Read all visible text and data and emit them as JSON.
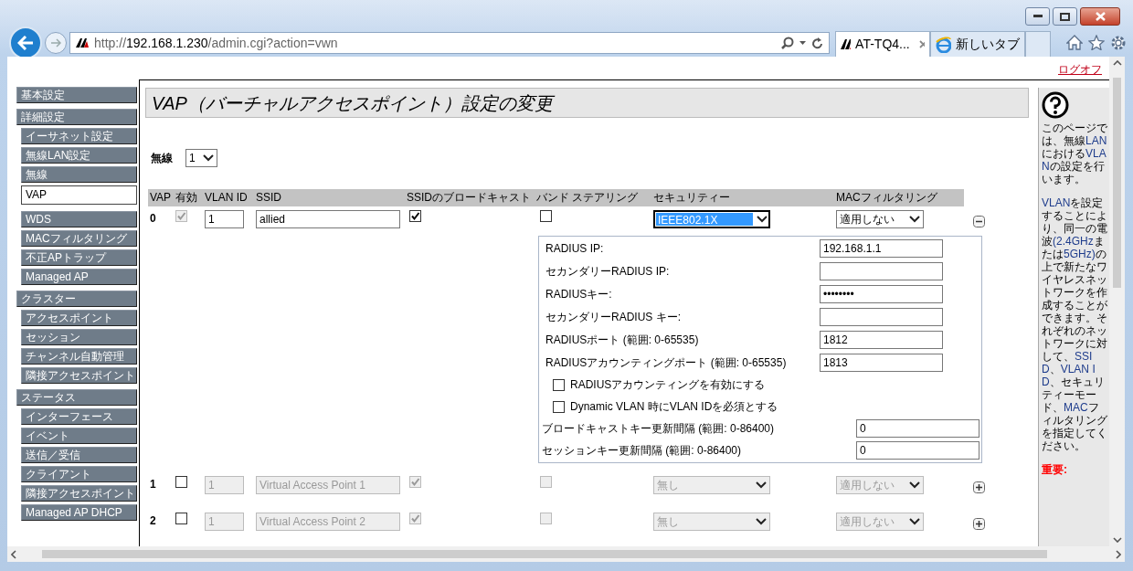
{
  "browser": {
    "address": "http://192.168.1.230/admin.cgi?action=vwn",
    "tabs": [
      {
        "label": "AT-TQ4...",
        "selected": true
      },
      {
        "label": "新しいタブ",
        "selected": false
      }
    ]
  },
  "logoff": "ログオフ",
  "sidebar": {
    "groups": [
      {
        "label": "基本設定"
      },
      {
        "label": "詳細設定",
        "items": [
          {
            "label": "イーサネット設定",
            "selected": false
          },
          {
            "label": "無線LAN設定",
            "selected": false
          },
          {
            "label": "無線",
            "selected": false
          },
          {
            "label": "VAP",
            "selected": true
          },
          {
            "label": "WDS",
            "selected": false
          },
          {
            "label": "MACフィルタリング",
            "selected": false
          },
          {
            "label": "不正APトラップ",
            "selected": false
          },
          {
            "label": "Managed AP",
            "selected": false
          }
        ]
      },
      {
        "label": "クラスター",
        "items": [
          {
            "label": "アクセスポイント",
            "selected": false
          },
          {
            "label": "セッション",
            "selected": false
          },
          {
            "label": "チャンネル自動管理",
            "selected": false
          },
          {
            "label": "隣接アクセスポイント",
            "selected": false
          }
        ]
      },
      {
        "label": "ステータス",
        "items": [
          {
            "label": "インターフェース",
            "selected": false
          },
          {
            "label": "イベント",
            "selected": false
          },
          {
            "label": "送信／受信",
            "selected": false
          },
          {
            "label": "クライアント",
            "selected": false
          },
          {
            "label": "隣接アクセスポイント",
            "selected": false
          },
          {
            "label": "Managed AP DHCP",
            "selected": false
          }
        ]
      }
    ]
  },
  "page_title": "VAP（バーチャルアクセスポイント）設定の変更",
  "radio": {
    "label": "無線",
    "value": "1"
  },
  "table": {
    "columns": [
      "VAP",
      "有効",
      "VLAN ID",
      "SSID",
      "SSIDのブロードキャスト",
      "バンド ステアリング",
      "セキュリティー",
      "MACフィルタリング"
    ],
    "rows": [
      {
        "vap": "0",
        "enabled": true,
        "enabled_locked": true,
        "vlan_id": "1",
        "ssid": "allied",
        "broadcast": true,
        "band_steering": false,
        "security": "IEEE802.1X",
        "security_focused": true,
        "mac_filter": "適用しない",
        "expanded": true,
        "radius": {
          "fields": [
            {
              "label": "RADIUS IP:",
              "value": "192.168.1.1"
            },
            {
              "label": "セカンダリーRADIUS IP:"
            },
            {
              "label": "RADIUSキー:",
              "value": "••••••••"
            },
            {
              "label": "セカンダリーRADIUS キー:"
            },
            {
              "label": "RADIUSポート (範囲: 0-65535)",
              "value": "1812"
            },
            {
              "label": "RADIUSアカウンティングポート (範囲: 0-65535)",
              "value": "1813"
            }
          ],
          "options": [
            {
              "label": "RADIUSアカウンティングを有効にする",
              "checked": false
            },
            {
              "label": "Dynamic VLAN 時にVLAN IDを必須とする",
              "checked": false
            }
          ],
          "intervals": [
            {
              "label": "ブロードキャストキー更新間隔 (範囲: 0-86400)",
              "value": "0"
            },
            {
              "label": "セッションキー更新間隔 (範囲: 0-86400)",
              "value": "0"
            }
          ]
        }
      },
      {
        "vap": "1",
        "enabled": false,
        "enabled_locked": false,
        "vlan_id": "1",
        "ssid": "Virtual Access Point 1",
        "broadcast": true,
        "band_steering": false,
        "security": "無し",
        "security_focused": false,
        "mac_filter": "適用しない",
        "expanded": false
      },
      {
        "vap": "2",
        "enabled": false,
        "enabled_locked": false,
        "vlan_id": "1",
        "ssid": "Virtual Access Point 2",
        "broadcast": true,
        "band_steering": false,
        "security": "無し",
        "security_focused": false,
        "mac_filter": "適用しない",
        "expanded": false
      }
    ]
  },
  "help": {
    "paragraphs": [
      "このページでは、無線LANにおけるVLANの設定を行います。",
      "VLANを設定することにより、同一の電波(2.4GHzまたは5GHz)の上で新たなワイヤレスネットワークを作成することができます。それぞれのネットワークに対して、SSID、VLAN ID、セキュリティーモード、MACフィルタリングを指定してください。"
    ],
    "warning": "重要:"
  }
}
